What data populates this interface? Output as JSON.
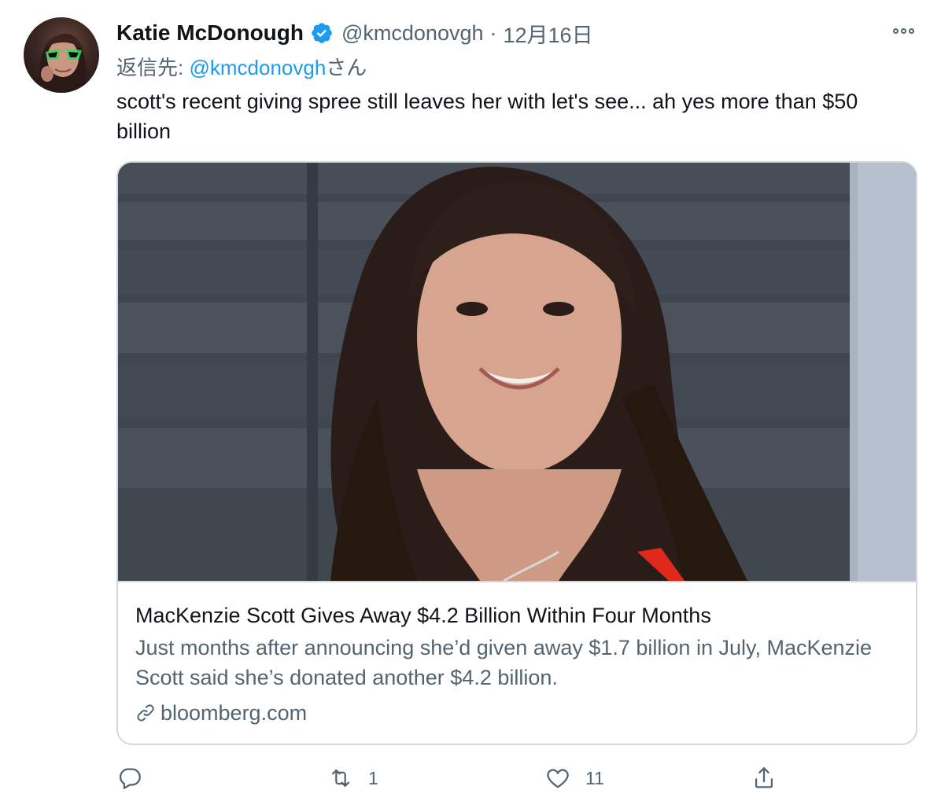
{
  "tweet": {
    "author_name": "Katie McDonough",
    "author_handle": "@kmcdonovgh",
    "separator": "·",
    "date": "12月16日",
    "reply_prefix": "返信先:",
    "reply_mention": "@kmcdonovgh",
    "reply_suffix": "さん",
    "text": "scott's recent giving spree still leaves her with let's see... ah yes more than $50 billion"
  },
  "card": {
    "title": "MacKenzie Scott Gives Away $4.2 Billion Within Four Months",
    "description": "Just months after announcing she’d given away $1.7 billion in July, MacKenzie Scott said she’s donated another $4.2 billion.",
    "domain": "bloomberg.com"
  },
  "actions": {
    "retweets": "1",
    "likes": "11"
  },
  "colors": {
    "verified": "#1d9bf0",
    "mention": "#1d9bf0",
    "secondary_text": "#536471",
    "border": "#cfd9de"
  },
  "icons": [
    "verified-badge-icon",
    "more-options-icon",
    "link-icon",
    "reply-icon",
    "retweet-icon",
    "like-icon",
    "share-icon"
  ]
}
